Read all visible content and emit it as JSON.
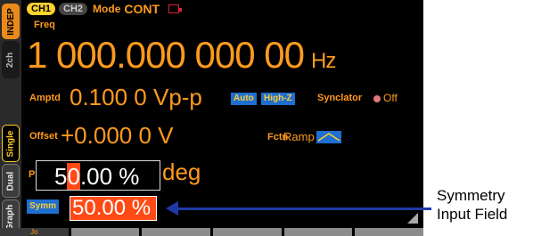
{
  "sidebar": {
    "tabs": [
      {
        "label": "INDEP"
      },
      {
        "label": "2ch"
      },
      {
        "label": "Single"
      },
      {
        "label": "Dual"
      },
      {
        "label": "Graph"
      }
    ]
  },
  "topbar": {
    "ch1": "CH1",
    "ch2": "CH2",
    "mode_label": "Mode",
    "mode_value": "CONT"
  },
  "freq": {
    "label": "Freq",
    "value": "1 000.000 000 00",
    "unit": "Hz"
  },
  "amptd": {
    "label": "Amptd",
    "value": "0.100 0 Vp-p",
    "auto": "Auto",
    "highz": "High-Z"
  },
  "synclator": {
    "label": "Synclator",
    "state": "Off"
  },
  "offset": {
    "label": "Offset",
    "value": "+0.000 0 V"
  },
  "fctn": {
    "label": "Fctn",
    "value": "Ramp"
  },
  "phase": {
    "label": "P",
    "unit": "deg"
  },
  "popup": {
    "before_cursor": "5",
    "cursor_digit": "0",
    "after_cursor": ".00 %"
  },
  "symm": {
    "label": "Symm",
    "value": "50.00 %"
  },
  "softkeys": {
    "first": "Jo"
  },
  "callout": {
    "line1": "Symmetry",
    "line2": "Input Field"
  },
  "colors": {
    "accent": "#ff9a1e",
    "highlight": "#ff4a16",
    "badge": "#1e6fd0",
    "callout": "#1f3aa8"
  }
}
